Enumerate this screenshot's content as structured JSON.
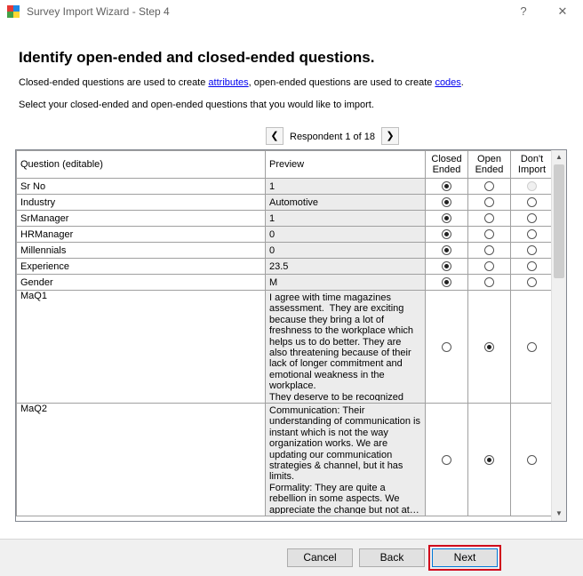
{
  "window": {
    "title": "Survey Import Wizard - Step 4",
    "help_glyph": "?",
    "close_glyph": "✕"
  },
  "heading": "Identify open-ended and closed-ended questions.",
  "description": {
    "part1": "Closed-ended questions are used to create ",
    "link_attributes": "attributes",
    "part2": ", open-ended questions are used to create ",
    "link_codes": "codes",
    "part3": "."
  },
  "instruction": "Select your closed-ended and open-ended questions that you would like to import.",
  "respondent": {
    "label": "Respondent 1 of 18",
    "prev_glyph": "❮",
    "next_glyph": "❯"
  },
  "grid": {
    "headers": {
      "question": "Question (editable)",
      "preview": "Preview",
      "closed_1": "Closed",
      "closed_2": "Ended",
      "open_1": "Open",
      "open_2": "Ended",
      "dont_1": "Don't",
      "dont_2": "Import"
    },
    "rows": [
      {
        "question": "Sr No",
        "preview": "1",
        "selection": "closed",
        "dont_disabled": true
      },
      {
        "question": "Industry",
        "preview": "Automotive",
        "selection": "closed"
      },
      {
        "question": "SrManager",
        "preview": "1",
        "selection": "closed"
      },
      {
        "question": "HRManager",
        "preview": "0",
        "selection": "closed"
      },
      {
        "question": "Millennials",
        "preview": "0",
        "selection": "closed"
      },
      {
        "question": "Experience",
        "preview": "23.5",
        "selection": "closed"
      },
      {
        "question": "Gender",
        "preview": "M",
        "selection": "closed"
      },
      {
        "question": "MaQ1",
        "preview": "I agree with time magazines assessment.  They are exciting because they bring a lot of freshness to the workplace which helps us to do better. They are also threatening because of their lack of longer commitment and emotional weakness in the workplace.\nThey deserve to be recognized a…",
        "selection": "open",
        "tall": true
      },
      {
        "question": "MaQ2",
        "preview": "Communication: Their understanding of communication is instant which is not the way organization works. We are updating our communication strategies & channel, but it has limits.\nFormality: They are quite a rebellion in some aspects. We appreciate the change but not at…",
        "selection": "open",
        "tall": true
      }
    ]
  },
  "buttons": {
    "cancel": "Cancel",
    "back": "Back",
    "next": "Next"
  },
  "colors": {
    "highlight": "#d0021b",
    "link": "#0000ee"
  }
}
